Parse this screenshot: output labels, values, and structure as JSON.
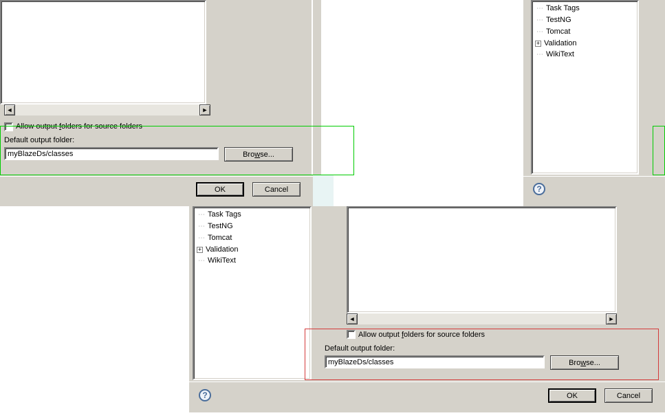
{
  "panel1": {
    "allow_output_label_pre": "Allow output ",
    "allow_output_label_u": "f",
    "allow_output_label_post": "olders for source folders",
    "default_folder_label": "Default output folder:",
    "default_folder_value": "myBlazeDs/classes",
    "browse_label_pre": "Bro",
    "browse_label_u": "w",
    "browse_label_post": "se...",
    "ok_label": "OK",
    "cancel_label": "Cancel"
  },
  "panel3": {
    "allow_output_label_pre": "Allow output ",
    "allow_output_label_u": "f",
    "allow_output_label_post": "olders for source folders",
    "default_folder_label": "Default output folder:",
    "default_folder_value": "myBlazeDs/classes",
    "browse_label_pre": "Bro",
    "browse_label_u": "w",
    "browse_label_post": "se...",
    "ok_label": "OK",
    "cancel_label": "Cancel"
  },
  "tree_right": {
    "items": [
      {
        "label": "Task Tags",
        "expand": ""
      },
      {
        "label": "TestNG",
        "expand": ""
      },
      {
        "label": "Tomcat",
        "expand": ""
      },
      {
        "label": "Validation",
        "expand": "+"
      },
      {
        "label": "WikiText",
        "expand": ""
      }
    ]
  },
  "tree_mid": {
    "items": [
      {
        "label": "Task Tags",
        "expand": ""
      },
      {
        "label": "TestNG",
        "expand": ""
      },
      {
        "label": "Tomcat",
        "expand": ""
      },
      {
        "label": "Validation",
        "expand": "+"
      },
      {
        "label": "WikiText",
        "expand": ""
      }
    ]
  },
  "icons": {
    "left": "◄",
    "right": "►",
    "help": "?"
  }
}
